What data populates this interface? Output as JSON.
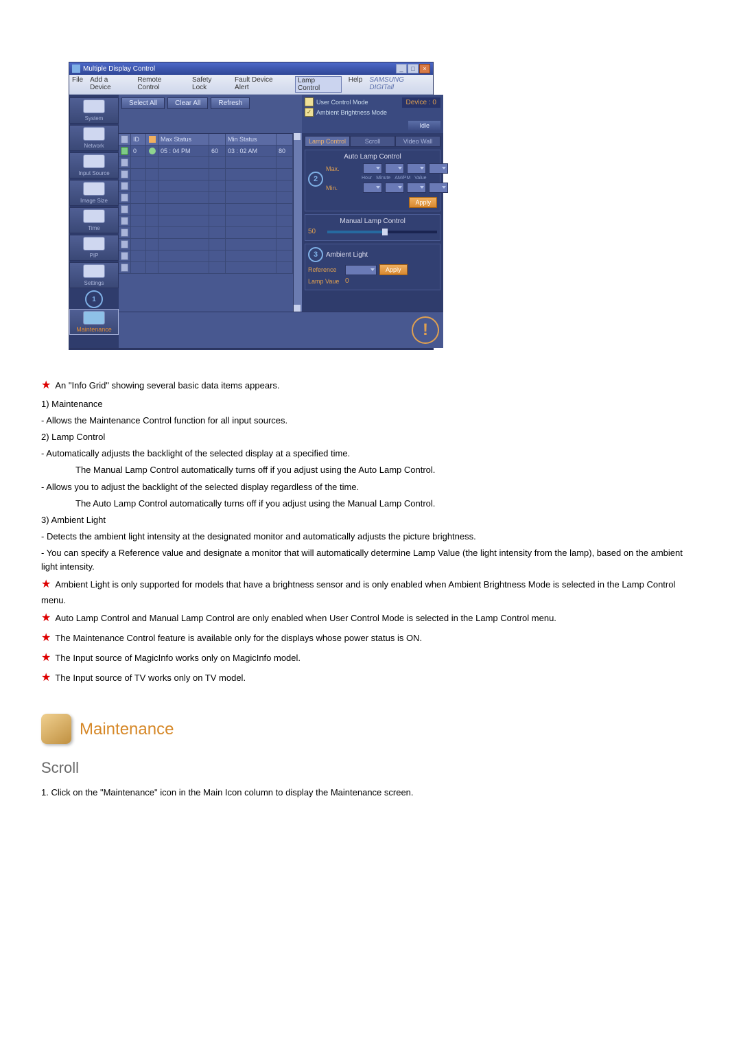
{
  "window": {
    "title": "Multiple Display Control",
    "menu": [
      "File",
      "Add a Device",
      "Remote Control",
      "Safety Lock",
      "Fault Device Alert",
      "Lamp Control",
      "Help"
    ],
    "menu_active_index": 5,
    "brand": "SAMSUNG DIGITall"
  },
  "mode_toggles": {
    "user_control": "User Control Mode",
    "ambient_mode": "Ambient Brightness Mode",
    "device_label": "Device : 0",
    "idle": "Idle"
  },
  "toolbar": {
    "select_all": "Select All",
    "clear_all": "Clear All",
    "refresh": "Refresh"
  },
  "sidebar": {
    "items": [
      "System",
      "Network",
      "Input Source",
      "Image Size",
      "Time",
      "PIP",
      "Settings",
      "Maintenance"
    ]
  },
  "badges": {
    "one": "1",
    "two": "2",
    "three": "3"
  },
  "grid": {
    "headers": {
      "id": "ID",
      "stat": "",
      "max": "Max Status",
      "mx": "",
      "min": "Min Status",
      "mn": ""
    },
    "rows": [
      {
        "id": "0",
        "max": "05 : 04  PM",
        "mx": "60",
        "min": "03 : 02  AM",
        "mn": "80",
        "checked": true,
        "status": "green"
      }
    ],
    "empty_count": 10
  },
  "right_panel": {
    "tabs": [
      "Lamp Control",
      "Scroll",
      "Video Wall"
    ],
    "active_tab": 0,
    "auto_title": "Auto Lamp Control",
    "max": "Max.",
    "min": "Min.",
    "col_labels": [
      "Hour",
      "Minute",
      "AM/PM",
      "Value"
    ],
    "apply": "Apply",
    "manual_title": "Manual Lamp Control",
    "manual_value": "50",
    "ambient_title": "Ambient Light",
    "reference": "Reference",
    "lamp_value_label": "Lamp Vaue",
    "lamp_value": "0"
  },
  "doc": {
    "p1": "An \"Info Grid\" showing several basic data items appears.",
    "n1": "1) Maintenance",
    "n1a": "- Allows the Maintenance Control function for all input sources.",
    "n2": "2) Lamp Control",
    "n2a": "- Automatically adjusts the backlight of the selected display at a specified time.",
    "n2a2": "The Manual Lamp Control automatically turns off if you adjust using the Auto Lamp Control.",
    "n2b": "- Allows you to adjust the backlight of the selected display regardless of the time.",
    "n2b2": "The Auto Lamp Control automatically turns off if you adjust using the Manual Lamp Control.",
    "n3": "3) Ambient Light",
    "n3a": "- Detects the ambient light intensity at the designated monitor and automatically adjusts the picture brightness.",
    "n3b": "- You can specify a Reference value and designate a monitor that will automatically determine Lamp Value (the light intensity from the lamp), based on the ambient light intensity.",
    "s1": "Ambient Light is only supported for models that have a brightness sensor and is only enabled when Ambient Brightness Mode is selected in the Lamp Control menu.",
    "s2": "Auto Lamp Control and Manual Lamp Control are only enabled when User Control Mode is selected in the Lamp Control menu.",
    "s3": "The Maintenance Control feature is available only for the displays whose power status is ON.",
    "s4": "The Input source of MagicInfo works only on MagicInfo model.",
    "s5": "The Input source of TV works only on TV model.",
    "maint_heading": "Maintenance",
    "scroll_heading": "Scroll",
    "scroll_1": "1. Click on the \"Maintenance\" icon in the Main Icon column to display the Maintenance screen."
  }
}
